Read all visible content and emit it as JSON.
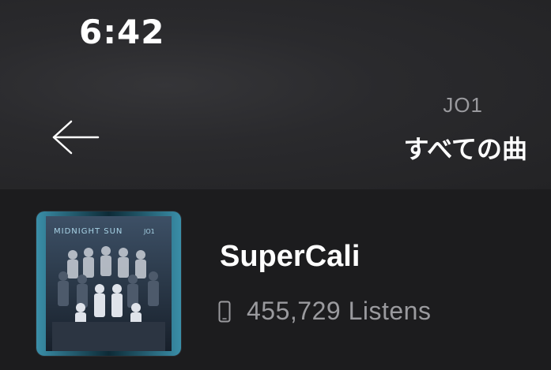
{
  "status_bar": {
    "time": "6:42"
  },
  "header": {
    "back_icon": "arrow-left-icon",
    "artist": "JO1",
    "title": "すべての曲"
  },
  "song": {
    "title": "SuperCali",
    "listens_icon": "phone-icon",
    "listens": "455,729 Listens",
    "cover": {
      "album_text": "MIDNIGHT SUN",
      "badge_text": "JO1"
    }
  },
  "colors": {
    "background": "#1c1c1e",
    "header_background": "#2a2a2d",
    "primary_text": "#ffffff",
    "secondary_text": "#9a9a9e"
  }
}
